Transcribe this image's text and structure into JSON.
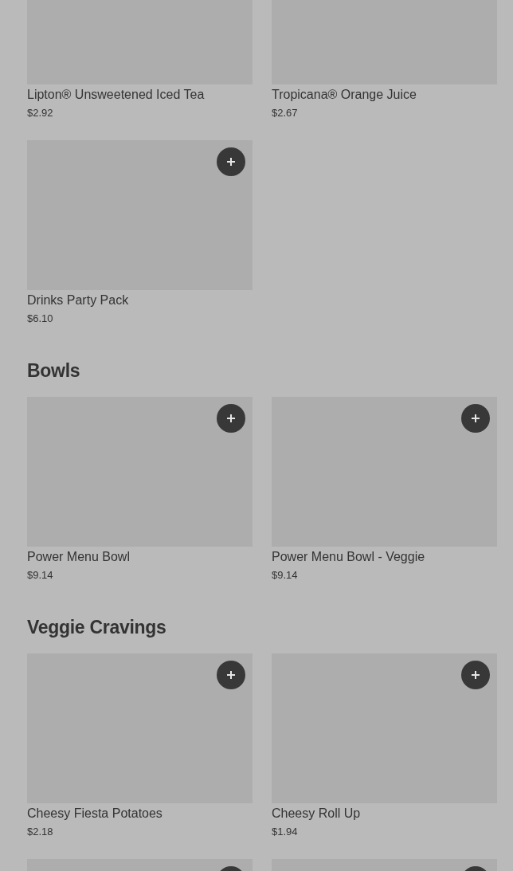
{
  "sections": [
    {
      "items": [
        {
          "name": "Lipton® Unsweetened Iced Tea",
          "price": "$2.92"
        },
        {
          "name": "Tropicana® Orange Juice",
          "price": "$2.67"
        },
        {
          "add_button": true,
          "name": "Drinks Party Pack",
          "price": "$6.10"
        }
      ]
    },
    {
      "heading": "Bowls",
      "items": [
        {
          "add_button": true,
          "name": "Power Menu Bowl",
          "price": "$9.14"
        },
        {
          "add_button": true,
          "name": "Power Menu Bowl - Veggie",
          "price": "$9.14"
        }
      ]
    },
    {
      "heading": "Veggie Cravings",
      "items": [
        {
          "add_button": true,
          "name": "Cheesy Fiesta Potatoes",
          "price": "$2.18"
        },
        {
          "add_button": true,
          "name": "Cheesy Roll Up",
          "price": "$1.94"
        },
        {
          "add_button": true
        },
        {
          "add_button": true
        }
      ]
    }
  ]
}
